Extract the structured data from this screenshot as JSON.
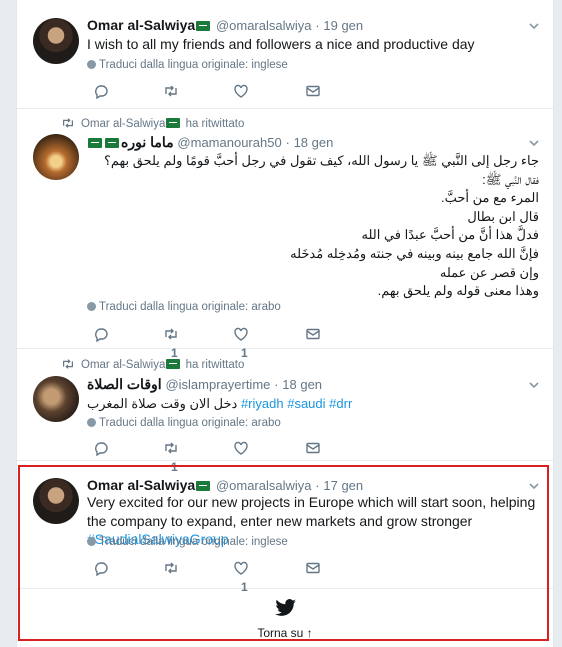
{
  "tweets": [
    {
      "name": "Omar al-Salwiya",
      "handle": "@omaralsalwiya",
      "time": "19 gen",
      "text": "I wish to all my friends and followers a nice and productive day",
      "translate": "Traduci dalla lingua originale: inglese",
      "retweets": "",
      "likes": ""
    },
    {
      "retweeted_by": "Omar al-Salwiya",
      "retweeted_label": "ha ritwittato",
      "name": "ماما نوره",
      "handle": "@mamanourah50",
      "time": "18 gen",
      "text_lines": [
        "جاء رجل إلى النَّبي ﷺ يا رسول الله، كيف تقول في رجل أحبَّ قومًا ولم يلحق بهم؟",
        "فقال النَّبي ﷺ:",
        "المرء مع من أحبَّ.",
        "قال ابن بطال",
        "فدلَّ هذا أنَّ من أحبَّ عبدًا في الله",
        "فإنَّ الله جامع بينه وبينه في جنته ومُدخِله مُدخَله",
        "وإن قصر عن عمله",
        "وهذا معنى قوله ولم يلحق بهم."
      ],
      "translate": "Traduci dalla lingua originale: arabo",
      "retweets": "1",
      "likes": "1"
    },
    {
      "retweeted_by": "Omar al-Salwiya",
      "retweeted_label": "ha ritwittato",
      "name": "اوقات الصلاة",
      "handle": "@islamprayertime",
      "time": "18 gen",
      "text_arabic": "دخل الان وقت صلاة المغرب",
      "hashtags": [
        "#riyadh",
        "#saudi",
        "#drr"
      ],
      "translate": "Traduci dalla lingua originale: arabo",
      "retweets": "1",
      "likes": ""
    },
    {
      "name": "Omar al-Salwiya",
      "handle": "@omaralsalwiya",
      "time": "17 gen",
      "text": "Very excited for our new projects in Europe which will start soon, helping the company to expand, enter new markets and grow stronger",
      "hashtag": "#SaudialSalwiyaGroup",
      "translate": "Traduci dalla lingua originale: inglese",
      "retweets": "",
      "likes": "1"
    }
  ],
  "footer": {
    "back_to_top": "Torna su ↑"
  },
  "colors": {
    "accent": "#1b95e0",
    "highlight": "#d9201f",
    "flag": "#1b7a3a"
  },
  "icons": [
    "reply-icon",
    "retweet-icon",
    "like-icon",
    "message-icon",
    "chevron-down-icon",
    "globe-icon",
    "twitter-bird-icon",
    "saudi-flag-icon"
  ]
}
